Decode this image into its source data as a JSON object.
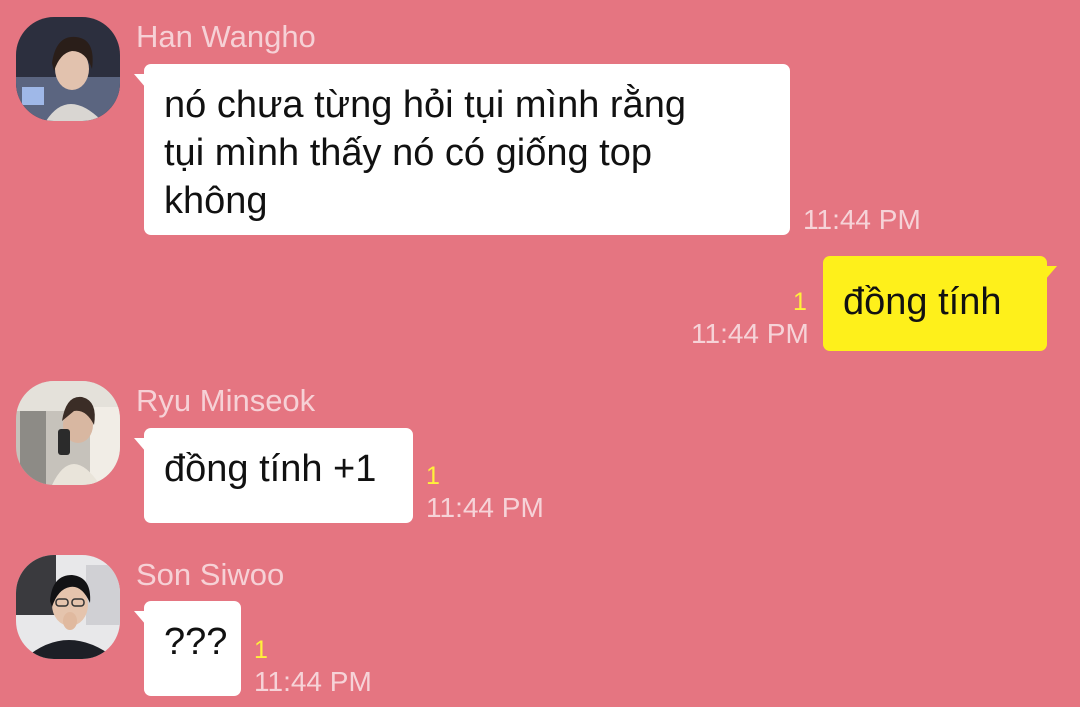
{
  "messages": [
    {
      "sender": "Han Wangho",
      "lines": [
        "nó chưa từng hỏi tụi mình rằng",
        "tụi mình thấy nó có giống top",
        "không"
      ],
      "time": "11:44 PM"
    },
    {
      "sender": "",
      "lines": [
        "đồng tính"
      ],
      "time": "11:44 PM",
      "unread": "1"
    },
    {
      "sender": "Ryu Minseok",
      "lines": [
        "đồng tính +1"
      ],
      "time": "11:44 PM",
      "unread": "1"
    },
    {
      "sender": "Son Siwoo",
      "lines": [
        "???"
      ],
      "time": "11:44 PM",
      "unread": "1"
    }
  ],
  "colors": {
    "background": "#e57581",
    "incoming_bubble": "#ffffff",
    "outgoing_bubble": "#fef01b",
    "unread_count": "#fff13b"
  }
}
